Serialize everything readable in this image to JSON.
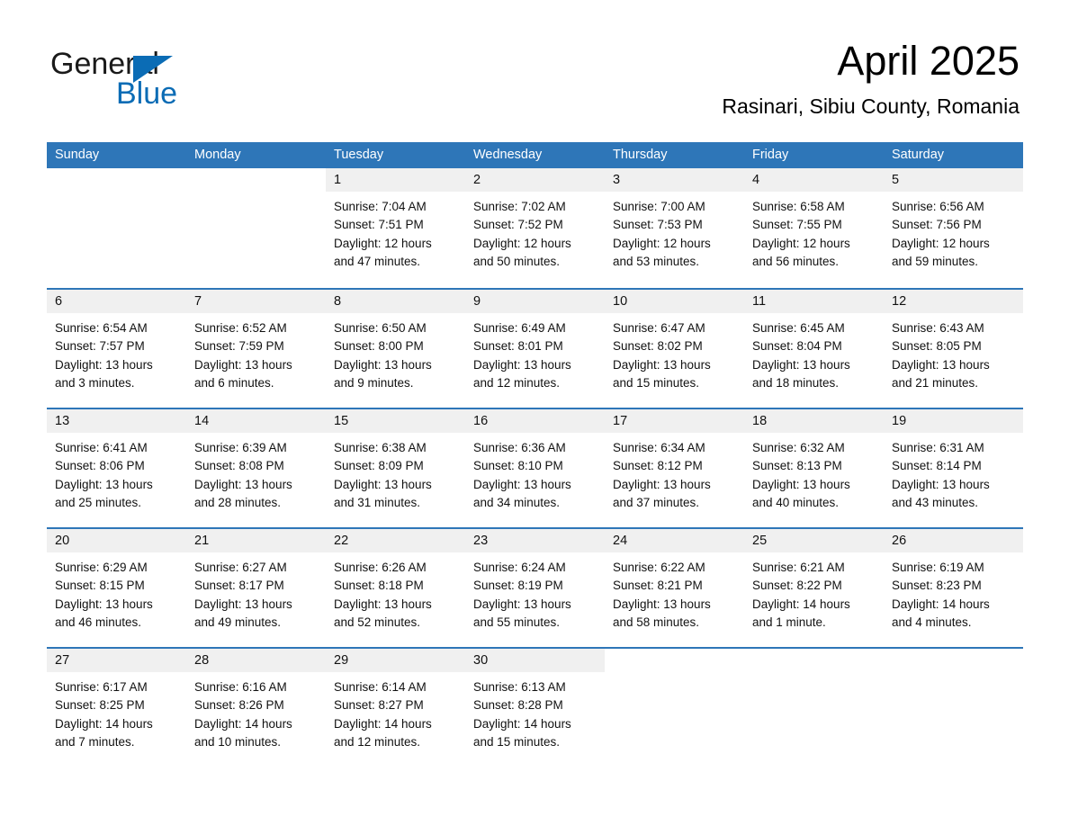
{
  "brand": {
    "line1": "General",
    "line2": "Blue",
    "accent_color": "#0b6cb5"
  },
  "header": {
    "title": "April 2025",
    "subtitle": "Rasinari, Sibiu County, Romania"
  },
  "theme": {
    "header_blue": "#2e76b8",
    "date_band_gray": "#f0f0f0",
    "text_color": "#111111"
  },
  "weekdays": [
    "Sunday",
    "Monday",
    "Tuesday",
    "Wednesday",
    "Thursday",
    "Friday",
    "Saturday"
  ],
  "weeks": [
    [
      {
        "day": "",
        "sunrise": "",
        "sunset": "",
        "daylight_l1": "",
        "daylight_l2": "",
        "blank": true
      },
      {
        "day": "",
        "sunrise": "",
        "sunset": "",
        "daylight_l1": "",
        "daylight_l2": "",
        "blank": true
      },
      {
        "day": "1",
        "sunrise": "Sunrise: 7:04 AM",
        "sunset": "Sunset: 7:51 PM",
        "daylight_l1": "Daylight: 12 hours",
        "daylight_l2": "and 47 minutes."
      },
      {
        "day": "2",
        "sunrise": "Sunrise: 7:02 AM",
        "sunset": "Sunset: 7:52 PM",
        "daylight_l1": "Daylight: 12 hours",
        "daylight_l2": "and 50 minutes."
      },
      {
        "day": "3",
        "sunrise": "Sunrise: 7:00 AM",
        "sunset": "Sunset: 7:53 PM",
        "daylight_l1": "Daylight: 12 hours",
        "daylight_l2": "and 53 minutes."
      },
      {
        "day": "4",
        "sunrise": "Sunrise: 6:58 AM",
        "sunset": "Sunset: 7:55 PM",
        "daylight_l1": "Daylight: 12 hours",
        "daylight_l2": "and 56 minutes."
      },
      {
        "day": "5",
        "sunrise": "Sunrise: 6:56 AM",
        "sunset": "Sunset: 7:56 PM",
        "daylight_l1": "Daylight: 12 hours",
        "daylight_l2": "and 59 minutes."
      }
    ],
    [
      {
        "day": "6",
        "sunrise": "Sunrise: 6:54 AM",
        "sunset": "Sunset: 7:57 PM",
        "daylight_l1": "Daylight: 13 hours",
        "daylight_l2": "and 3 minutes."
      },
      {
        "day": "7",
        "sunrise": "Sunrise: 6:52 AM",
        "sunset": "Sunset: 7:59 PM",
        "daylight_l1": "Daylight: 13 hours",
        "daylight_l2": "and 6 minutes."
      },
      {
        "day": "8",
        "sunrise": "Sunrise: 6:50 AM",
        "sunset": "Sunset: 8:00 PM",
        "daylight_l1": "Daylight: 13 hours",
        "daylight_l2": "and 9 minutes."
      },
      {
        "day": "9",
        "sunrise": "Sunrise: 6:49 AM",
        "sunset": "Sunset: 8:01 PM",
        "daylight_l1": "Daylight: 13 hours",
        "daylight_l2": "and 12 minutes."
      },
      {
        "day": "10",
        "sunrise": "Sunrise: 6:47 AM",
        "sunset": "Sunset: 8:02 PM",
        "daylight_l1": "Daylight: 13 hours",
        "daylight_l2": "and 15 minutes."
      },
      {
        "day": "11",
        "sunrise": "Sunrise: 6:45 AM",
        "sunset": "Sunset: 8:04 PM",
        "daylight_l1": "Daylight: 13 hours",
        "daylight_l2": "and 18 minutes."
      },
      {
        "day": "12",
        "sunrise": "Sunrise: 6:43 AM",
        "sunset": "Sunset: 8:05 PM",
        "daylight_l1": "Daylight: 13 hours",
        "daylight_l2": "and 21 minutes."
      }
    ],
    [
      {
        "day": "13",
        "sunrise": "Sunrise: 6:41 AM",
        "sunset": "Sunset: 8:06 PM",
        "daylight_l1": "Daylight: 13 hours",
        "daylight_l2": "and 25 minutes."
      },
      {
        "day": "14",
        "sunrise": "Sunrise: 6:39 AM",
        "sunset": "Sunset: 8:08 PM",
        "daylight_l1": "Daylight: 13 hours",
        "daylight_l2": "and 28 minutes."
      },
      {
        "day": "15",
        "sunrise": "Sunrise: 6:38 AM",
        "sunset": "Sunset: 8:09 PM",
        "daylight_l1": "Daylight: 13 hours",
        "daylight_l2": "and 31 minutes."
      },
      {
        "day": "16",
        "sunrise": "Sunrise: 6:36 AM",
        "sunset": "Sunset: 8:10 PM",
        "daylight_l1": "Daylight: 13 hours",
        "daylight_l2": "and 34 minutes."
      },
      {
        "day": "17",
        "sunrise": "Sunrise: 6:34 AM",
        "sunset": "Sunset: 8:12 PM",
        "daylight_l1": "Daylight: 13 hours",
        "daylight_l2": "and 37 minutes."
      },
      {
        "day": "18",
        "sunrise": "Sunrise: 6:32 AM",
        "sunset": "Sunset: 8:13 PM",
        "daylight_l1": "Daylight: 13 hours",
        "daylight_l2": "and 40 minutes."
      },
      {
        "day": "19",
        "sunrise": "Sunrise: 6:31 AM",
        "sunset": "Sunset: 8:14 PM",
        "daylight_l1": "Daylight: 13 hours",
        "daylight_l2": "and 43 minutes."
      }
    ],
    [
      {
        "day": "20",
        "sunrise": "Sunrise: 6:29 AM",
        "sunset": "Sunset: 8:15 PM",
        "daylight_l1": "Daylight: 13 hours",
        "daylight_l2": "and 46 minutes."
      },
      {
        "day": "21",
        "sunrise": "Sunrise: 6:27 AM",
        "sunset": "Sunset: 8:17 PM",
        "daylight_l1": "Daylight: 13 hours",
        "daylight_l2": "and 49 minutes."
      },
      {
        "day": "22",
        "sunrise": "Sunrise: 6:26 AM",
        "sunset": "Sunset: 8:18 PM",
        "daylight_l1": "Daylight: 13 hours",
        "daylight_l2": "and 52 minutes."
      },
      {
        "day": "23",
        "sunrise": "Sunrise: 6:24 AM",
        "sunset": "Sunset: 8:19 PM",
        "daylight_l1": "Daylight: 13 hours",
        "daylight_l2": "and 55 minutes."
      },
      {
        "day": "24",
        "sunrise": "Sunrise: 6:22 AM",
        "sunset": "Sunset: 8:21 PM",
        "daylight_l1": "Daylight: 13 hours",
        "daylight_l2": "and 58 minutes."
      },
      {
        "day": "25",
        "sunrise": "Sunrise: 6:21 AM",
        "sunset": "Sunset: 8:22 PM",
        "daylight_l1": "Daylight: 14 hours",
        "daylight_l2": "and 1 minute."
      },
      {
        "day": "26",
        "sunrise": "Sunrise: 6:19 AM",
        "sunset": "Sunset: 8:23 PM",
        "daylight_l1": "Daylight: 14 hours",
        "daylight_l2": "and 4 minutes."
      }
    ],
    [
      {
        "day": "27",
        "sunrise": "Sunrise: 6:17 AM",
        "sunset": "Sunset: 8:25 PM",
        "daylight_l1": "Daylight: 14 hours",
        "daylight_l2": "and 7 minutes."
      },
      {
        "day": "28",
        "sunrise": "Sunrise: 6:16 AM",
        "sunset": "Sunset: 8:26 PM",
        "daylight_l1": "Daylight: 14 hours",
        "daylight_l2": "and 10 minutes."
      },
      {
        "day": "29",
        "sunrise": "Sunrise: 6:14 AM",
        "sunset": "Sunset: 8:27 PM",
        "daylight_l1": "Daylight: 14 hours",
        "daylight_l2": "and 12 minutes."
      },
      {
        "day": "30",
        "sunrise": "Sunrise: 6:13 AM",
        "sunset": "Sunset: 8:28 PM",
        "daylight_l1": "Daylight: 14 hours",
        "daylight_l2": "and 15 minutes."
      },
      {
        "day": "",
        "sunrise": "",
        "sunset": "",
        "daylight_l1": "",
        "daylight_l2": "",
        "blank": true
      },
      {
        "day": "",
        "sunrise": "",
        "sunset": "",
        "daylight_l1": "",
        "daylight_l2": "",
        "blank": true
      },
      {
        "day": "",
        "sunrise": "",
        "sunset": "",
        "daylight_l1": "",
        "daylight_l2": "",
        "blank": true
      }
    ]
  ]
}
